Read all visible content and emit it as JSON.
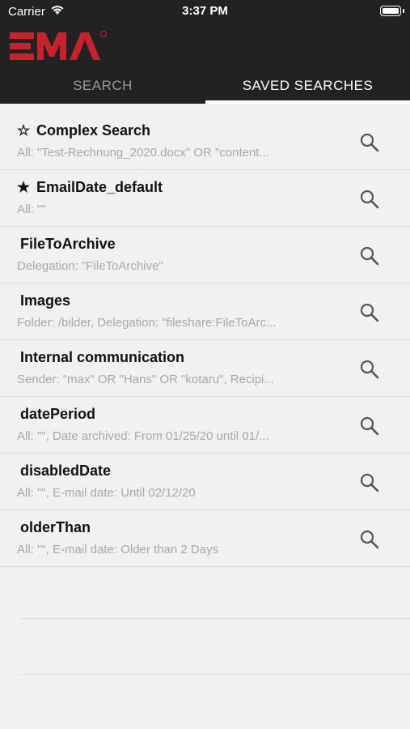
{
  "status_bar": {
    "carrier": "Carrier",
    "time": "3:37 PM"
  },
  "header": {
    "logo_text": "EMA"
  },
  "tabs": [
    {
      "label": "SEARCH",
      "active": false
    },
    {
      "label": "SAVED SEARCHES",
      "active": true
    }
  ],
  "saved_searches": [
    {
      "title": "Complex Search",
      "star": "☆",
      "subtitle": "All: \"Test-Rechnung_2020.docx\" OR \"content..."
    },
    {
      "title": "EmailDate_default",
      "star": "★",
      "subtitle": "All: \"\""
    },
    {
      "title": "FileToArchive",
      "star": "",
      "subtitle": "Delegation: \"FileToArchive\""
    },
    {
      "title": "Images",
      "star": "",
      "subtitle": "Folder: /bilder, Delegation: \"fileshare:FileToArc..."
    },
    {
      "title": "Internal communication",
      "star": "",
      "subtitle": "Sender: \"max\" OR \"Hans\" OR \"kotaru\", Recipi..."
    },
    {
      "title": "datePeriod",
      "star": "",
      "subtitle": "All: \"\", Date archived:  From 01/25/20 until 01/..."
    },
    {
      "title": "disabledDate",
      "star": "",
      "subtitle": "All: \"\", E-mail date:  Until 02/12/20"
    },
    {
      "title": "olderThan",
      "star": "",
      "subtitle": "All: \"\", E-mail date: Older than 2 Days"
    }
  ],
  "colors": {
    "header_bg": "#222222",
    "logo_red": "#c8232c",
    "list_bg": "#f2f1ef",
    "subtitle": "#a8a8a8"
  },
  "icons": {
    "row_action": "search-icon",
    "wifi": "wifi-icon",
    "battery": "battery-icon"
  }
}
